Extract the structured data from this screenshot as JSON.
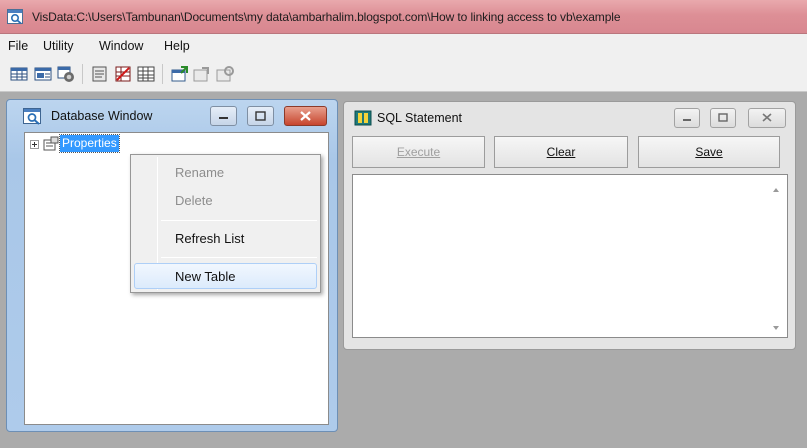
{
  "window": {
    "title": "VisData:C:\\Users\\Tambunan\\Documents\\my data\\ambarhalim.blogspot.com\\How to linking access to vb\\example"
  },
  "menubar": {
    "items": [
      {
        "label": "File"
      },
      {
        "label": "Utility"
      },
      {
        "label": "Window"
      },
      {
        "label": "Help"
      }
    ]
  },
  "toolbar": {
    "icons": [
      "table-type-icon",
      "dynaset-type-icon",
      "snapshot-type-icon",
      "data-control-icon",
      "dbgrid-icon",
      "grid-icon",
      "begin-transaction-icon",
      "commit-icon",
      "rollback-icon"
    ]
  },
  "database_window": {
    "title": "Database Window",
    "tree": [
      {
        "label": "Properties",
        "selected": true,
        "expandable": true
      }
    ]
  },
  "sql_window": {
    "title": "SQL Statement",
    "buttons": {
      "execute": {
        "label": "Execute",
        "enabled": false
      },
      "clear": {
        "label": "Clear",
        "enabled": true
      },
      "save": {
        "label": "Save",
        "enabled": true
      }
    },
    "editor_text": ""
  },
  "context_menu": {
    "items": [
      {
        "label": "Rename",
        "enabled": false
      },
      {
        "label": "Delete",
        "enabled": false
      },
      {
        "label": "Refresh List",
        "enabled": true
      },
      {
        "label": "New Table",
        "enabled": true,
        "highlighted": true
      }
    ]
  },
  "colors": {
    "titlebar": "#dd8f96",
    "active_frame": "#aecbeb",
    "selection": "#3399ff",
    "mdi_background": "#ababab"
  }
}
